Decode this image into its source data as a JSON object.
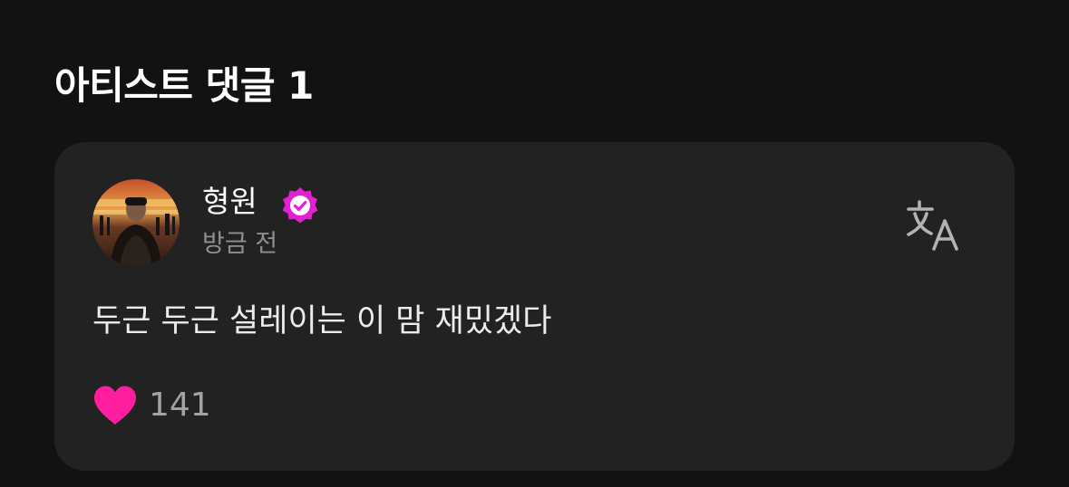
{
  "section": {
    "title": "아티스트 댓글 1"
  },
  "comment": {
    "author": {
      "name": "형원",
      "verified_icon": "verified-badge-icon",
      "avatar": "avatar-photo"
    },
    "timestamp": "방금 전",
    "translate_icon": "translate-icon",
    "text": "두근 두근 설레이는 이 맘 재밌겠다",
    "likes": {
      "icon": "heart-icon",
      "count": "141"
    }
  },
  "colors": {
    "background": "#121212",
    "card": "#222222",
    "verified_badge": "#e21fd2",
    "heart": "#ff1f9e",
    "muted_text": "#8f8f8f"
  }
}
